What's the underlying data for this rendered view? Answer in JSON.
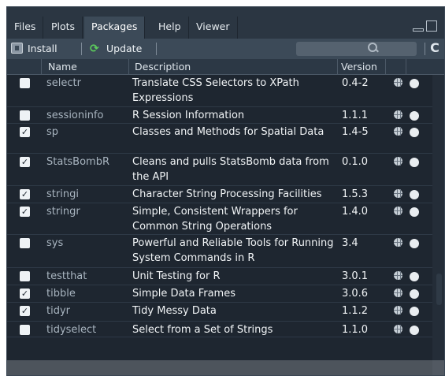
{
  "tabs": [
    {
      "label": "Files",
      "active": false
    },
    {
      "label": "Plots",
      "active": false
    },
    {
      "label": "Packages",
      "active": true
    },
    {
      "label": "Help",
      "active": false
    },
    {
      "label": "Viewer",
      "active": false
    }
  ],
  "toolbar": {
    "install_label": "Install",
    "update_label": "Update",
    "search_placeholder": "",
    "install_icon": "install-icon",
    "update_icon": "refresh-icon"
  },
  "columns": {
    "name": "Name",
    "description": "Description",
    "version": "Version"
  },
  "packages": [
    {
      "name": "selectr",
      "description": "Translate CSS Selectors to XPath Expressions",
      "version": "0.4-2",
      "loaded": false
    },
    {
      "name": "sessioninfo",
      "description": "R Session Information",
      "version": "1.1.1",
      "loaded": false
    },
    {
      "name": "sp",
      "description": "Classes and Methods for Spatial Data",
      "version": "1.4-5",
      "loaded": true
    },
    {
      "name": "StatsBombR",
      "description": "Cleans and pulls StatsBomb data from the API",
      "version": "0.1.0",
      "loaded": true
    },
    {
      "name": "stringi",
      "description": "Character String Processing Facilities",
      "version": "1.5.3",
      "loaded": true
    },
    {
      "name": "stringr",
      "description": "Simple, Consistent Wrappers for Common String Operations",
      "version": "1.4.0",
      "loaded": true
    },
    {
      "name": "sys",
      "description": "Powerful and Reliable Tools for Running System Commands in R",
      "version": "3.4",
      "loaded": false
    },
    {
      "name": "testthat",
      "description": "Unit Testing for R",
      "version": "3.0.1",
      "loaded": false
    },
    {
      "name": "tibble",
      "description": "Simple Data Frames",
      "version": "3.0.6",
      "loaded": true
    },
    {
      "name": "tidyr",
      "description": "Tidy Messy Data",
      "version": "1.1.2",
      "loaded": true
    },
    {
      "name": "tidyselect",
      "description": "Select from a Set of Strings",
      "version": "1.1.0",
      "loaded": false
    }
  ],
  "colors": {
    "panel": "#1e2630",
    "toolbar": "#3c4a58",
    "update_icon": "#5ccc5c"
  }
}
